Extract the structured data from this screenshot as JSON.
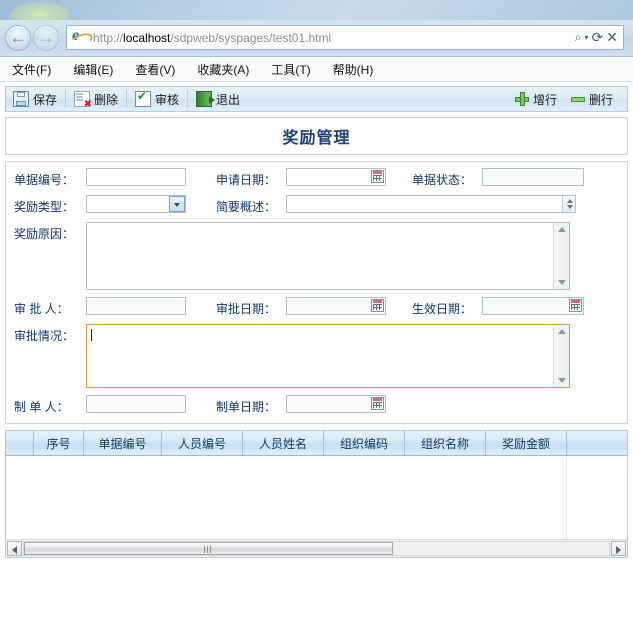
{
  "browser": {
    "back_label": "←",
    "forward_label": "→",
    "url_scheme": "http://",
    "url_host": "localhost",
    "url_path": "/sdpweb/syspages/test01.html",
    "search_icon": "search-icon",
    "caret_icon": "chevron-down-icon",
    "refresh_icon": "refresh-icon",
    "close_icon": "close-icon",
    "refresh_glyph": "⟳",
    "close_glyph": "✕",
    "search_glyph": "⌕",
    "caret_glyph": "▾",
    "menu": [
      {
        "label": "文件(F)"
      },
      {
        "label": "编辑(E)"
      },
      {
        "label": "查看(V)"
      },
      {
        "label": "收藏夹(A)"
      },
      {
        "label": "工具(T)"
      },
      {
        "label": "帮助(H)"
      }
    ]
  },
  "toolbar": {
    "left_buttons": [
      {
        "label": "保存",
        "icon": "save-icon"
      },
      {
        "label": "删除",
        "icon": "delete-icon"
      },
      {
        "label": "审核",
        "icon": "audit-check-icon"
      },
      {
        "label": "退出",
        "icon": "exit-icon"
      }
    ],
    "right_buttons": [
      {
        "label": "增行",
        "icon": "add-row-plus-icon"
      },
      {
        "label": "删行",
        "icon": "remove-row-minus-icon"
      }
    ]
  },
  "page_title": "奖励管理",
  "form": {
    "doc_no": {
      "label": "单据编号：",
      "value": ""
    },
    "apply_date": {
      "label": "申请日期：",
      "value": "",
      "picker_icon": "calendar-icon"
    },
    "doc_status": {
      "label": "单据状态：",
      "value": ""
    },
    "reward_type": {
      "label": "奖励类型：",
      "value": "",
      "dropdown_icon": "chevron-down-icon"
    },
    "brief": {
      "label": "简要概述：",
      "value": "",
      "spinner_icon": "spinner-icon"
    },
    "reward_reason": {
      "label": "奖励原因：",
      "value": ""
    },
    "approver": {
      "label": "审 批 人：",
      "value": ""
    },
    "approve_date": {
      "label": "审批日期：",
      "value": "",
      "picker_icon": "calendar-icon"
    },
    "effective_date": {
      "label": "生效日期：",
      "value": "",
      "picker_icon": "calendar-icon"
    },
    "approve_note": {
      "label": "审批情况：",
      "value": "",
      "focused": true
    },
    "maker": {
      "label": "制 单 人：",
      "value": ""
    },
    "make_date": {
      "label": "制单日期：",
      "value": "",
      "picker_icon": "calendar-icon"
    }
  },
  "grid": {
    "columns": [
      {
        "label": "序号"
      },
      {
        "label": "单据编号"
      },
      {
        "label": "人员编号"
      },
      {
        "label": "人员姓名"
      },
      {
        "label": "组织编码"
      },
      {
        "label": "组织名称"
      },
      {
        "label": "奖励金额"
      }
    ],
    "rows": [],
    "scroll": {
      "left_arrow": "scroll-left-icon",
      "right_arrow": "scroll-right-icon"
    }
  },
  "colors": {
    "title_blue": "#1d3f7a",
    "label_blue": "#13356e",
    "focus_orange": "#dd9933",
    "grid_header_blue": "#c6dff5"
  }
}
